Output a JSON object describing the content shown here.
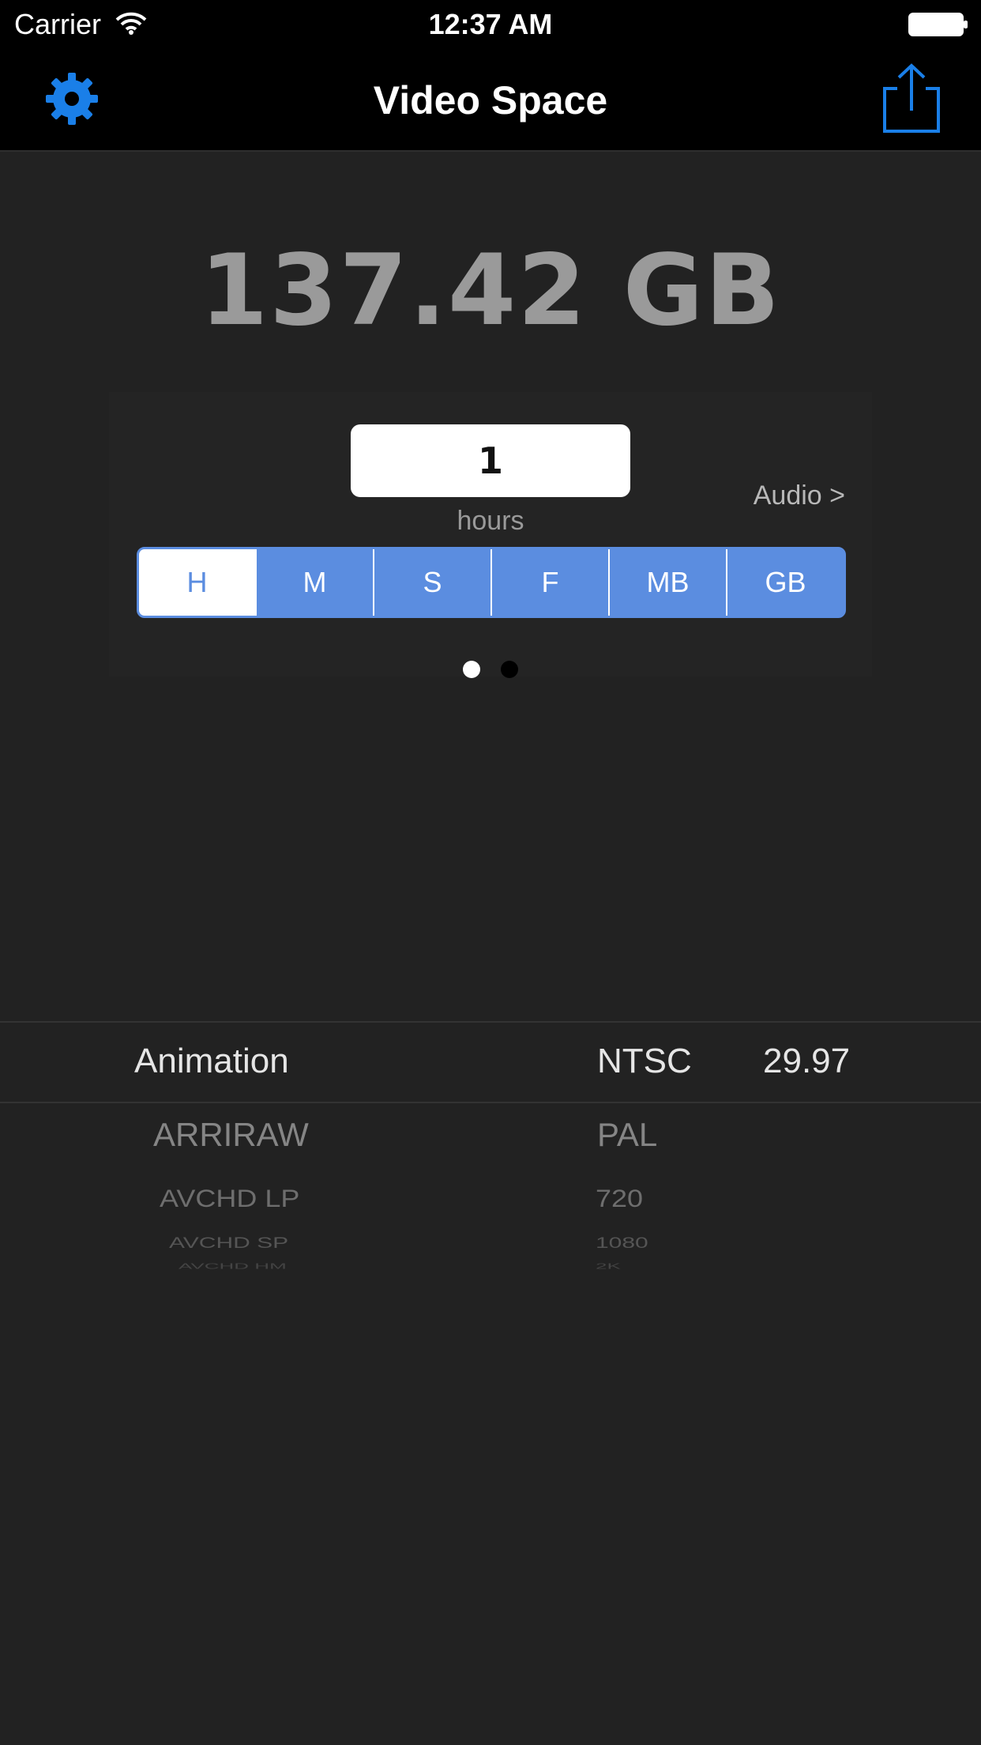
{
  "status_bar": {
    "carrier": "Carrier",
    "time": "12:37 AM"
  },
  "nav": {
    "title": "Video Space",
    "gear_icon": "gear-icon",
    "share_icon": "share-icon",
    "accent_color": "#1a7fe8"
  },
  "result": {
    "total": "137.42 GB"
  },
  "input": {
    "value": "1",
    "unit_label": "hours"
  },
  "audio_link": "Audio >",
  "segments": {
    "items": [
      "H",
      "M",
      "S",
      "F",
      "MB",
      "GB"
    ],
    "selected": "H",
    "color": "#5b8de0"
  },
  "page_control": {
    "current_page": 1,
    "page_count": 2
  },
  "picker": {
    "formats": [
      "Animation",
      "ARRIRAW",
      "AVCHD LP",
      "AVCHD SP",
      "AVCHD HM"
    ],
    "standards": [
      "NTSC",
      "PAL",
      "720",
      "1080",
      "2K"
    ],
    "frame_rate": "29.97"
  }
}
